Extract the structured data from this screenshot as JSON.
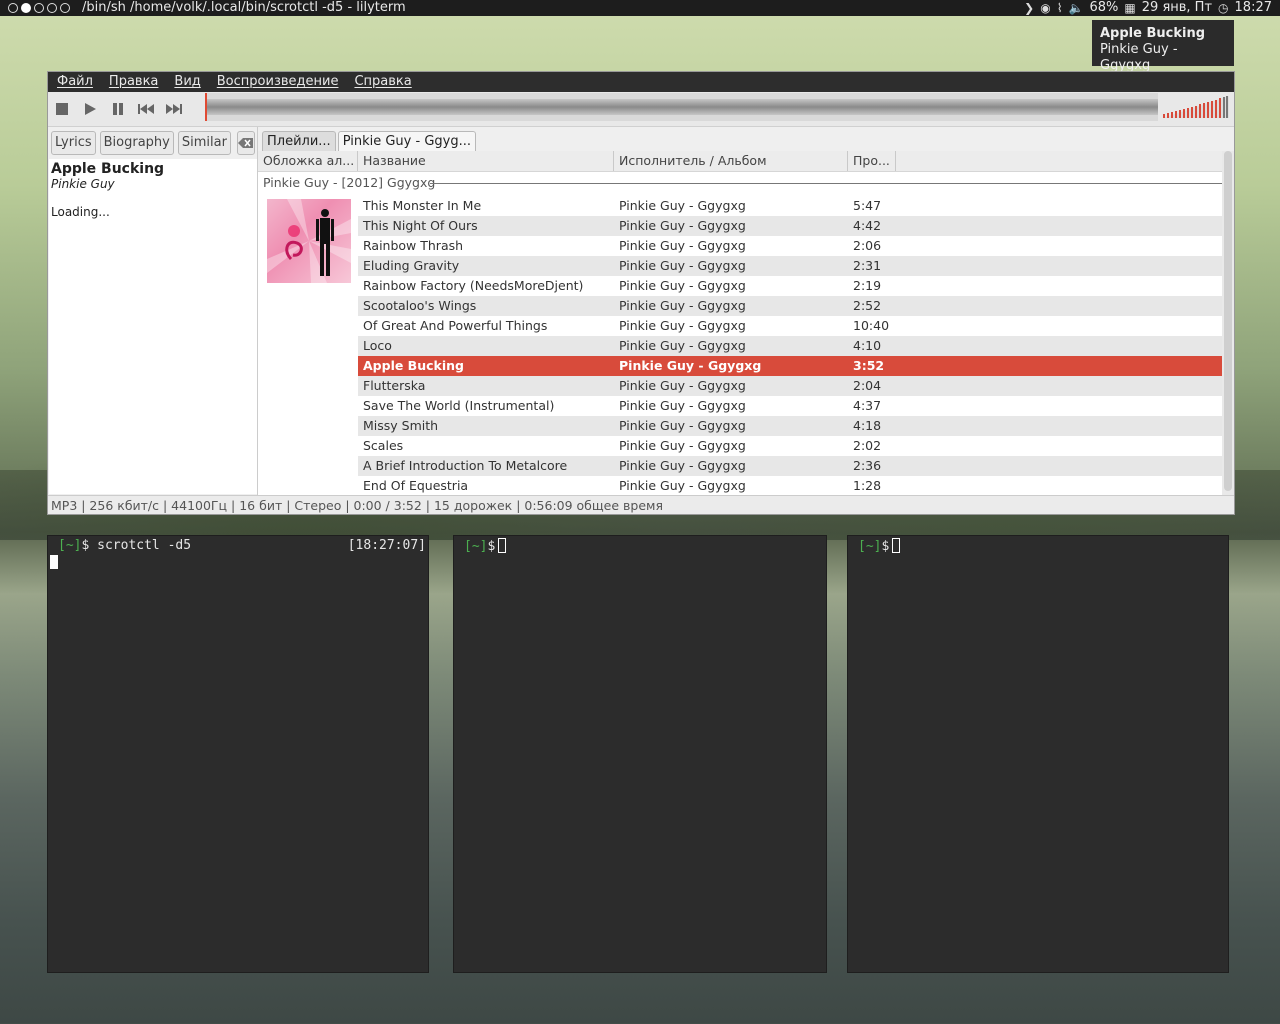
{
  "panel": {
    "title": "/bin/sh /home/volk/.local/bin/scrotctl -d5 - lilyterm",
    "volume": "68%",
    "date": "29 янв, Пт",
    "time": "18:27"
  },
  "notification": {
    "title": "Apple Bucking",
    "subtitle": "Pinkie Guy - Ggygxg"
  },
  "menu": [
    "Файл",
    "Правка",
    "Вид",
    "Воспроизведение",
    "Справка"
  ],
  "side": {
    "tabs": [
      "Lyrics",
      "Biography",
      "Similar"
    ],
    "song_title": "Apple Bucking",
    "song_artist": "Pinkie Guy",
    "loading": "Loading..."
  },
  "playlist": {
    "tabs": [
      "Плейли...",
      "Pinkie Guy - Ggyg..."
    ],
    "headers": [
      "Обложка ал...",
      "Название",
      "Исполнитель / Альбом",
      "Про..."
    ],
    "group": "Pinkie Guy - [2012] Ggygxg",
    "rows": [
      {
        "title": "This Monster In Me",
        "artist": "Pinkie Guy - Ggygxg",
        "len": "5:47"
      },
      {
        "title": "This Night Of Ours",
        "artist": "Pinkie Guy - Ggygxg",
        "len": "4:42"
      },
      {
        "title": "Rainbow Thrash",
        "artist": "Pinkie Guy - Ggygxg",
        "len": "2:06"
      },
      {
        "title": "Eluding Gravity",
        "artist": "Pinkie Guy - Ggygxg",
        "len": "2:31"
      },
      {
        "title": "Rainbow Factory (NeedsMoreDjent)",
        "artist": "Pinkie Guy - Ggygxg",
        "len": "2:19"
      },
      {
        "title": "Scootaloo's Wings",
        "artist": "Pinkie Guy - Ggygxg",
        "len": "2:52"
      },
      {
        "title": "Of Great And Powerful Things",
        "artist": "Pinkie Guy - Ggygxg",
        "len": "10:40"
      },
      {
        "title": "Loco",
        "artist": "Pinkie Guy - Ggygxg",
        "len": "4:10"
      },
      {
        "title": "Apple Bucking",
        "artist": "Pinkie Guy - Ggygxg",
        "len": "3:52",
        "selected": true
      },
      {
        "title": "Flutterska",
        "artist": "Pinkie Guy - Ggygxg",
        "len": "2:04"
      },
      {
        "title": "Save The World (Instrumental)",
        "artist": "Pinkie Guy - Ggygxg",
        "len": "4:37"
      },
      {
        "title": "Missy Smith",
        "artist": "Pinkie Guy - Ggygxg",
        "len": "4:18"
      },
      {
        "title": "Scales",
        "artist": "Pinkie Guy - Ggygxg",
        "len": "2:02"
      },
      {
        "title": "A Brief Introduction To Metalcore",
        "artist": "Pinkie Guy - Ggygxg",
        "len": "2:36"
      },
      {
        "title": "End Of Equestria",
        "artist": "Pinkie Guy - Ggygxg",
        "len": "1:28"
      }
    ]
  },
  "status": "MP3 |  256 кбит/с | 44100Гц | 16 бит | Стерео | 0:00 / 3:52 | 15 дорожек | 0:56:09 общее время",
  "terminals": [
    {
      "prompt_dir": "[~]",
      "prompt_sign": "$",
      "command": " scrotctl -d5",
      "clock": "[18:27:07]"
    },
    {
      "prompt_dir": "[~]",
      "prompt_sign": "$",
      "command": ""
    },
    {
      "prompt_dir": "[~]",
      "prompt_sign": "$",
      "command": ""
    }
  ]
}
